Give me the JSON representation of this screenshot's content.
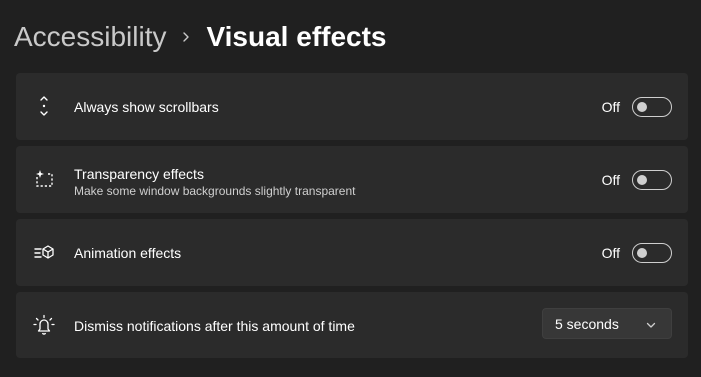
{
  "breadcrumb": {
    "parent": "Accessibility",
    "current": "Visual effects"
  },
  "settings": [
    {
      "title": "Always show scrollbars",
      "description": "",
      "state": "Off",
      "icon": "scrollbar-icon",
      "on": false
    },
    {
      "title": "Transparency effects",
      "description": "Make some window backgrounds slightly transparent",
      "state": "Off",
      "icon": "transparency-icon",
      "on": false
    },
    {
      "title": "Animation effects",
      "description": "",
      "state": "Off",
      "icon": "animation-icon",
      "on": false
    },
    {
      "title": "Dismiss notifications after this amount of time",
      "value": "5 seconds",
      "icon": "notification-timer-icon"
    }
  ],
  "colors": {
    "background": "#202020",
    "card": "#2b2b2b",
    "text": "#ffffff",
    "muted": "#cfcfcf"
  }
}
